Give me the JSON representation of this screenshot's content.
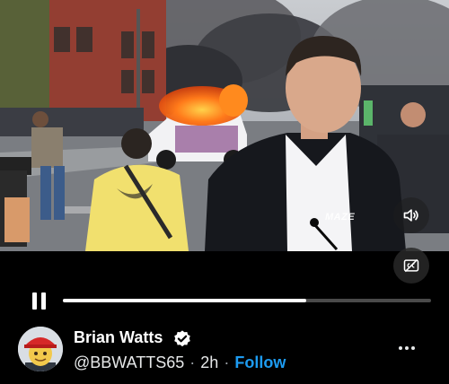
{
  "video": {
    "watermark": "MAZE",
    "progress_fraction": 0.66,
    "mute_icon": "speaker-icon",
    "cc_icon": "captions-off-icon"
  },
  "controls": {
    "pause_icon": "pause-icon"
  },
  "author": {
    "name": "Brian Watts",
    "handle": "@BBWATTS65",
    "time_ago": "2h",
    "follow_label": "Follow",
    "verified_icon": "verified-badge-icon",
    "more_icon": "more-options-icon"
  },
  "colors": {
    "background": "#000000",
    "accent": "#1d9bf0",
    "progress_track": "#4a4a4a",
    "progress_fill": "#ffffff"
  }
}
